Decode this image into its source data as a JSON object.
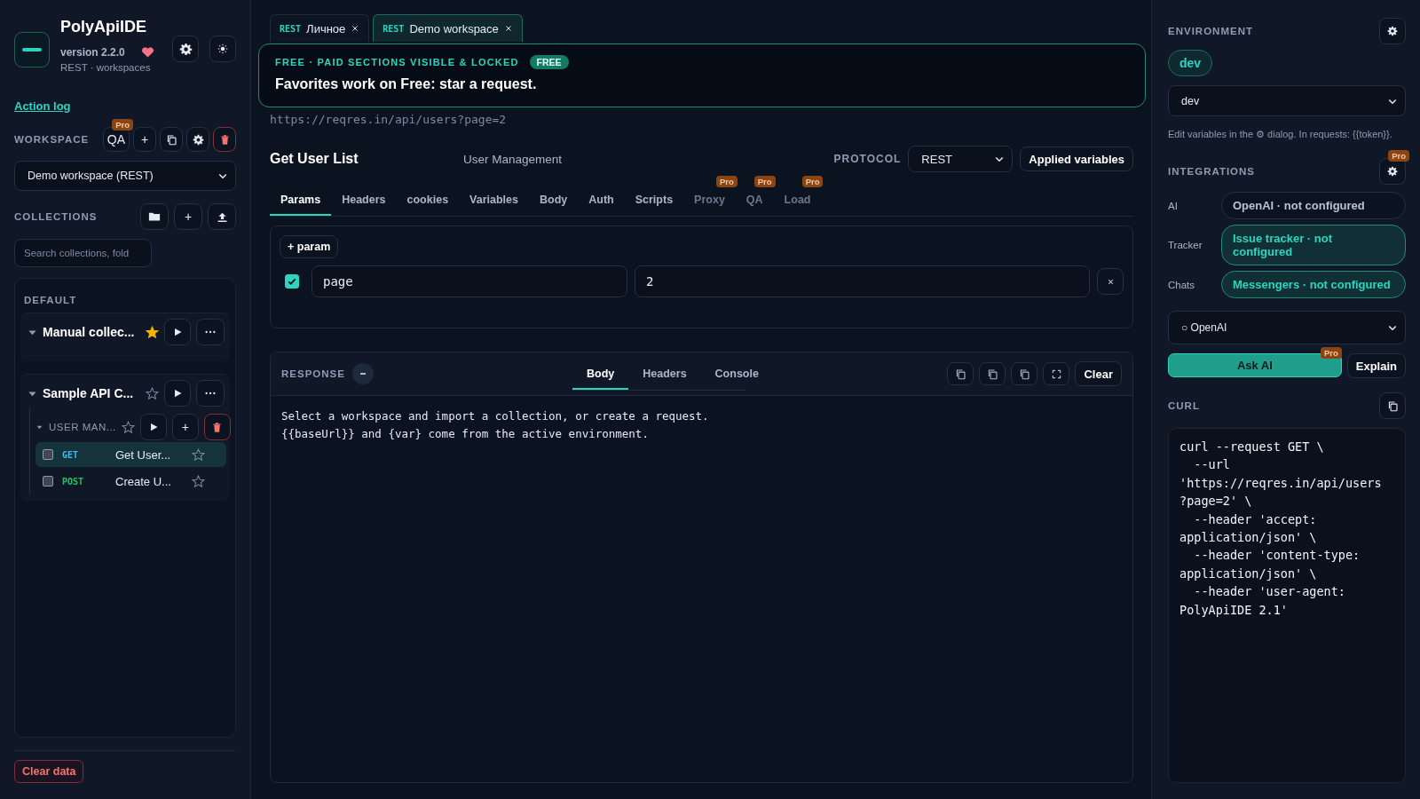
{
  "app": {
    "name": "PolyApiIDE",
    "version": "version 2.2.0",
    "subtitle": "REST · workspaces"
  },
  "sidebar": {
    "action_log": "Action log",
    "workspace": {
      "label": "WORKSPACE",
      "qa_button": "QA",
      "qa_badge": "Pro",
      "add_button": "+",
      "select_value": "Demo workspace (REST)"
    },
    "collections": {
      "label": "COLLECTIONS",
      "add_button": "+",
      "search_placeholder": "Search collections, fold"
    },
    "tree": {
      "group": "DEFAULT",
      "items": [
        {
          "name": "Manual collec...",
          "starred": true,
          "expanded": true
        },
        {
          "name": "Sample API C...",
          "starred": false,
          "expanded": true,
          "children": [
            {
              "name": "USER MAN...",
              "starred": false,
              "expanded": true,
              "add_button": "+",
              "requests": [
                {
                  "method": "GET",
                  "color": "#38bdf8",
                  "name": "Get User...",
                  "selected": true,
                  "checked": false,
                  "starred": false
                },
                {
                  "method": "POST",
                  "color": "#22c55e",
                  "name": "Create U...",
                  "selected": false,
                  "checked": false,
                  "starred": false
                }
              ]
            }
          ]
        }
      ]
    },
    "clear_button": "Clear data"
  },
  "open_tabs": [
    {
      "protocol": "REST",
      "title": "Личное",
      "selected": false
    },
    {
      "protocol": "REST",
      "title": "Demo workspace",
      "selected": true
    }
  ],
  "banner": {
    "heading": "FREE · PAID SECTIONS VISIBLE & LOCKED",
    "badge": "FREE",
    "message": "Favorites work on Free: star a request."
  },
  "request": {
    "url": "https://reqres.in/api/users?page=2",
    "title": "Get User List",
    "folder": "User Management",
    "protocol_label": "PROTOCOL",
    "protocol": "REST",
    "applied_button": "Applied variables",
    "tabs": [
      {
        "label": "Params",
        "selected": true,
        "locked": false
      },
      {
        "label": "Headers",
        "selected": false,
        "locked": false
      },
      {
        "label": "cookies",
        "selected": false,
        "locked": false
      },
      {
        "label": "Variables",
        "selected": false,
        "locked": false
      },
      {
        "label": "Body",
        "selected": false,
        "locked": false
      },
      {
        "label": "Auth",
        "selected": false,
        "locked": false
      },
      {
        "label": "Scripts",
        "selected": false,
        "locked": false
      },
      {
        "label": "Proxy",
        "selected": false,
        "locked": true,
        "badge": "Pro"
      },
      {
        "label": "QA",
        "selected": false,
        "locked": true,
        "badge": "Pro"
      },
      {
        "label": "Load",
        "selected": false,
        "locked": true,
        "badge": "Pro"
      }
    ],
    "add_param": "+ param",
    "params": [
      {
        "checked": true,
        "key": "page",
        "value": "2"
      }
    ]
  },
  "response": {
    "label": "RESPONSE",
    "tabs": [
      {
        "label": "Body",
        "selected": true
      },
      {
        "label": "Headers",
        "selected": false
      },
      {
        "label": "Console",
        "selected": false
      }
    ],
    "clear_button": "Clear",
    "lines": [
      "Select a workspace and import a collection, or create a request.",
      "{{baseUrl}} and {var} come from the active environment."
    ]
  },
  "environment": {
    "label": "ENVIRONMENT",
    "chip": "dev",
    "select_value": "dev",
    "hint": "Edit variables in the ⚙ dialog. In requests: {{token}}."
  },
  "integrations": {
    "label": "INTEGRATIONS",
    "badge": "Pro",
    "items": [
      {
        "label": "AI",
        "value": "OpenAI · not configured",
        "accent": false
      },
      {
        "label": "Tracker",
        "value": "Issue tracker · not configured",
        "accent": true
      },
      {
        "label": "Chats",
        "value": "Messengers · not configured",
        "accent": true
      }
    ],
    "provider_select": "○ OpenAI",
    "ask_button": "Ask AI",
    "ask_badge": "Pro",
    "explain_button": "Explain"
  },
  "curl": {
    "label": "CURL",
    "code": "curl --request GET \\\n  --url\n'https://reqres.in/api/users\n?page=2' \\\n  --header 'accept:\napplication/json' \\\n  --header 'content-type:\napplication/json' \\\n  --header 'user-agent:\nPolyApiIDE 2.1'"
  }
}
